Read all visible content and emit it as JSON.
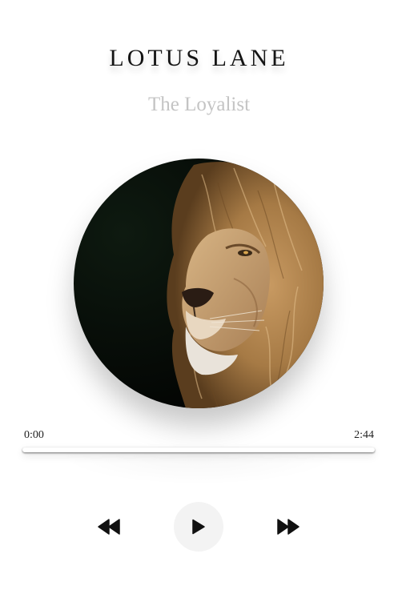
{
  "track": {
    "artist": "LOTUS LANE",
    "title": "The Loyalist"
  },
  "artwork": {
    "subject": "lion portrait",
    "colors": {
      "background": "#050805",
      "mane": "#b58a54",
      "face": "#c9a574"
    }
  },
  "playback": {
    "current_time": "0:00",
    "duration": "2:44",
    "progress_fraction": 0
  },
  "controls": {
    "previous_icon": "rewind-icon",
    "play_icon": "play-icon",
    "next_icon": "fast-forward-icon"
  },
  "colors": {
    "title": "#141414",
    "subtitle": "#c4c4c4",
    "play_button_bg": "#f3f3f3",
    "icon": "#111111"
  }
}
